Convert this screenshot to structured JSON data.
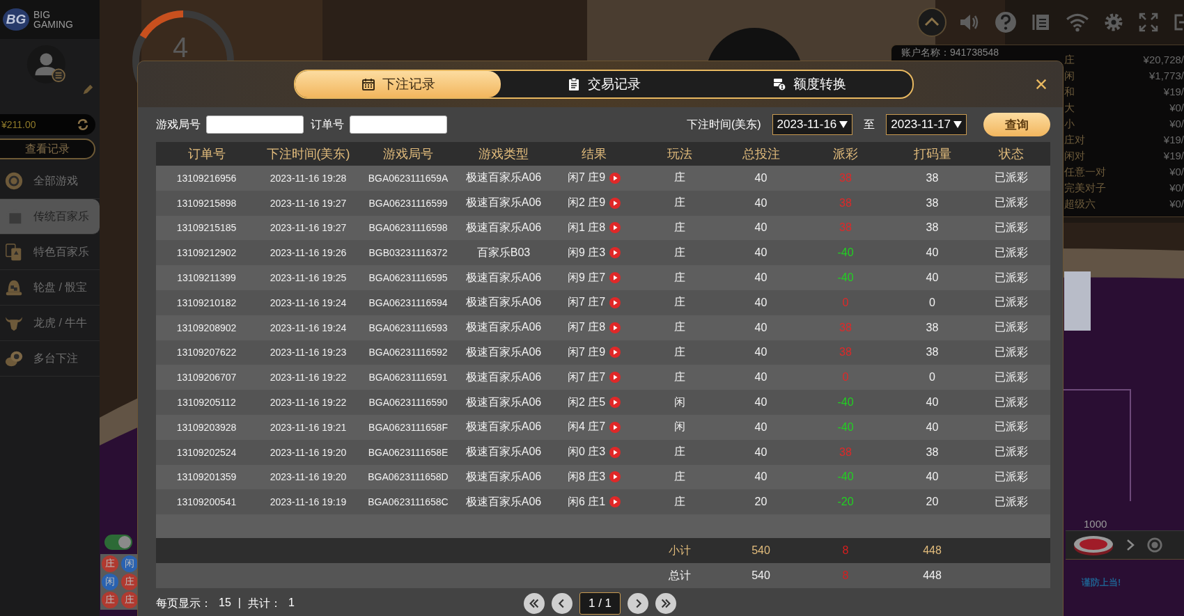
{
  "sidebar": {
    "logo_mark": "BG",
    "logo_text": [
      "BIG",
      "GAMING"
    ],
    "balance": "¥211.00",
    "records_button": "查看记录",
    "items": [
      {
        "label": "全部游戏",
        "selected": false
      },
      {
        "label": "传统百家乐",
        "selected": true
      },
      {
        "label": "特色百家乐",
        "selected": false
      },
      {
        "label": "轮盘 / 骰宝",
        "selected": false
      },
      {
        "label": "龙虎 / 牛牛",
        "selected": false
      },
      {
        "label": "多台下注",
        "selected": false
      }
    ]
  },
  "game": {
    "countdown": "4",
    "account": "账户名称：941738548",
    "toggle_on": true,
    "beads": [
      {
        "label": "庄",
        "color": "#b03a30"
      },
      {
        "label": "闲",
        "color": "#2a62b0"
      },
      {
        "label": "闲",
        "color": "#2a62b0"
      },
      {
        "label": "庄",
        "color": "#b03a30"
      },
      {
        "label": "庄",
        "color": "#b03a30"
      },
      {
        "label": "庄",
        "color": "#b03a30"
      }
    ],
    "limits": [
      {
        "label": "庄",
        "value": "¥20,728/"
      },
      {
        "label": "闲",
        "value": "¥1,773/"
      },
      {
        "label": "和",
        "value": "¥19/"
      },
      {
        "label": "大",
        "value": "¥0/"
      },
      {
        "label": "小",
        "value": "¥0/"
      },
      {
        "label": "庄对",
        "value": "¥19/"
      },
      {
        "label": "闲对",
        "value": "¥19/"
      },
      {
        "label": "任意一对",
        "value": "¥0/"
      },
      {
        "label": "完美对子",
        "value": "¥0/"
      },
      {
        "label": "超级六",
        "value": "¥0/"
      }
    ],
    "chip": "1000",
    "warning": "谨防上当!"
  },
  "dialog": {
    "tabs": [
      {
        "label": "下注记录",
        "selected": true
      },
      {
        "label": "交易记录",
        "selected": false
      },
      {
        "label": "额度转换",
        "selected": false
      }
    ],
    "filters": {
      "round_label": "游戏局号",
      "order_label": "订单号",
      "time_label": "下注时间(美东)",
      "date_from": "2023-11-16",
      "to_label": "至",
      "date_to": "2023-11-17",
      "query_button": "查询"
    },
    "table": {
      "columns": [
        "订单号",
        "下注时间(美东)",
        "游戏局号",
        "游戏类型",
        "结果",
        "玩法",
        "总投注",
        "派彩",
        "打码量",
        "状态"
      ],
      "rows": [
        {
          "order": "13109216956",
          "time": "2023-11-16 19:28",
          "round": "BGA0623111659A",
          "game": "极速百家乐A06",
          "result": "闲7 庄9",
          "bet": "庄",
          "stake": "40",
          "payout": "38",
          "color": "#e02828",
          "rolling": "38",
          "status": "已派彩"
        },
        {
          "order": "13109215898",
          "time": "2023-11-16 19:27",
          "round": "BGA06231116599",
          "game": "极速百家乐A06",
          "result": "闲2 庄9",
          "bet": "庄",
          "stake": "40",
          "payout": "38",
          "color": "#e02828",
          "rolling": "38",
          "status": "已派彩"
        },
        {
          "order": "13109215185",
          "time": "2023-11-16 19:27",
          "round": "BGA06231116598",
          "game": "极速百家乐A06",
          "result": "闲1 庄8",
          "bet": "庄",
          "stake": "40",
          "payout": "38",
          "color": "#e02828",
          "rolling": "38",
          "status": "已派彩"
        },
        {
          "order": "13109212902",
          "time": "2023-11-16 19:26",
          "round": "BGB03231116372",
          "game": "百家乐B03",
          "result": "闲9 庄3",
          "bet": "庄",
          "stake": "40",
          "payout": "-40",
          "color": "#22d022",
          "rolling": "40",
          "status": "已派彩"
        },
        {
          "order": "13109211399",
          "time": "2023-11-16 19:25",
          "round": "BGA06231116595",
          "game": "极速百家乐A06",
          "result": "闲9 庄7",
          "bet": "庄",
          "stake": "40",
          "payout": "-40",
          "color": "#22d022",
          "rolling": "40",
          "status": "已派彩"
        },
        {
          "order": "13109210182",
          "time": "2023-11-16 19:24",
          "round": "BGA06231116594",
          "game": "极速百家乐A06",
          "result": "闲7 庄7",
          "bet": "庄",
          "stake": "40",
          "payout": "0",
          "color": "#e02828",
          "rolling": "0",
          "status": "已派彩"
        },
        {
          "order": "13109208902",
          "time": "2023-11-16 19:24",
          "round": "BGA06231116593",
          "game": "极速百家乐A06",
          "result": "闲7 庄8",
          "bet": "庄",
          "stake": "40",
          "payout": "38",
          "color": "#e02828",
          "rolling": "38",
          "status": "已派彩"
        },
        {
          "order": "13109207622",
          "time": "2023-11-16 19:23",
          "round": "BGA06231116592",
          "game": "极速百家乐A06",
          "result": "闲7 庄9",
          "bet": "庄",
          "stake": "40",
          "payout": "38",
          "color": "#e02828",
          "rolling": "38",
          "status": "已派彩"
        },
        {
          "order": "13109206707",
          "time": "2023-11-16 19:22",
          "round": "BGA06231116591",
          "game": "极速百家乐A06",
          "result": "闲7 庄7",
          "bet": "庄",
          "stake": "40",
          "payout": "0",
          "color": "#e02828",
          "rolling": "0",
          "status": "已派彩"
        },
        {
          "order": "13109205112",
          "time": "2023-11-16 19:22",
          "round": "BGA06231116590",
          "game": "极速百家乐A06",
          "result": "闲2 庄5",
          "bet": "闲",
          "stake": "40",
          "payout": "-40",
          "color": "#22d022",
          "rolling": "40",
          "status": "已派彩"
        },
        {
          "order": "13109203928",
          "time": "2023-11-16 19:21",
          "round": "BGA0623111658F",
          "game": "极速百家乐A06",
          "result": "闲4 庄7",
          "bet": "闲",
          "stake": "40",
          "payout": "-40",
          "color": "#22d022",
          "rolling": "40",
          "status": "已派彩"
        },
        {
          "order": "13109202524",
          "time": "2023-11-16 19:20",
          "round": "BGA0623111658E",
          "game": "极速百家乐A06",
          "result": "闲0 庄3",
          "bet": "庄",
          "stake": "40",
          "payout": "38",
          "color": "#e02828",
          "rolling": "38",
          "status": "已派彩"
        },
        {
          "order": "13109201359",
          "time": "2023-11-16 19:20",
          "round": "BGA0623111658D",
          "game": "极速百家乐A06",
          "result": "闲8 庄3",
          "bet": "庄",
          "stake": "40",
          "payout": "-40",
          "color": "#22d022",
          "rolling": "40",
          "status": "已派彩"
        },
        {
          "order": "13109200541",
          "time": "2023-11-16 19:19",
          "round": "BGA0623111658C",
          "game": "极速百家乐A06",
          "result": "闲6 庄1",
          "bet": "庄",
          "stake": "20",
          "payout": "-20",
          "color": "#22d022",
          "rolling": "20",
          "status": "已派彩"
        }
      ],
      "subtotal": {
        "label": "小计",
        "stake": "540",
        "payout": "8",
        "rolling": "448"
      },
      "total": {
        "label": "总计",
        "stake": "540",
        "payout": "8",
        "rolling": "448"
      }
    },
    "footer": {
      "per_page_label": "每页显示：",
      "per_page": "15",
      "separator": "|",
      "count_label": "共计：",
      "count": "1",
      "page": "1 / 1"
    }
  }
}
